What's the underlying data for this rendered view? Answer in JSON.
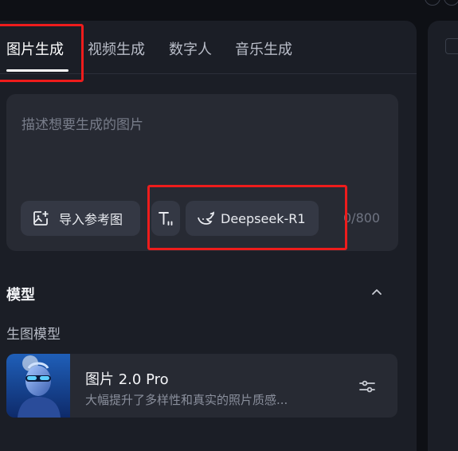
{
  "tabs": [
    {
      "label": "图片生成",
      "active": true
    },
    {
      "label": "视频生成",
      "active": false
    },
    {
      "label": "数字人",
      "active": false
    },
    {
      "label": "音乐生成",
      "active": false
    }
  ],
  "prompt": {
    "placeholder": "描述想要生成的图片",
    "value": "",
    "import_ref_label": "导入参考图",
    "model_chip_label": "Deepseek-R1",
    "counter": "0/800"
  },
  "model_section": {
    "title": "模型",
    "subtitle": "生图模型",
    "model": {
      "name": "图片 2.0 Pro",
      "description": "大幅提升了多样性和真实的照片质感..."
    }
  },
  "colors": {
    "background": "#0e1015",
    "panel": "#1b1e26",
    "input_box": "#272a33",
    "chip": "#343844",
    "highlight": "#ee1c1c"
  }
}
